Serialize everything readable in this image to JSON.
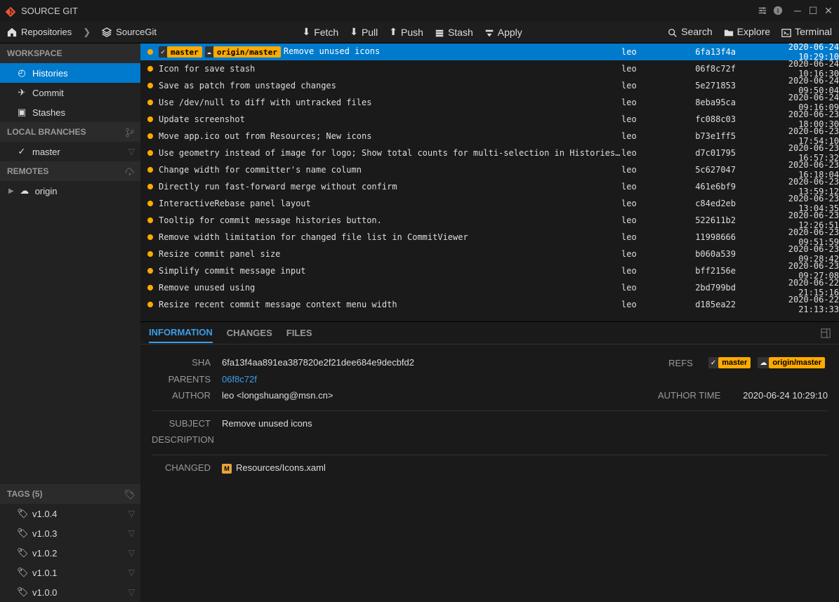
{
  "title": "SOURCE GIT",
  "breadcrumb": {
    "repositories": "Repositories",
    "current": "SourceGit"
  },
  "toolbar": {
    "fetch": "Fetch",
    "pull": "Pull",
    "push": "Push",
    "stash": "Stash",
    "apply": "Apply",
    "search": "Search",
    "explore": "Explore",
    "terminal": "Terminal"
  },
  "sidebar": {
    "workspace": {
      "label": "WORKSPACE",
      "items": [
        {
          "label": "Histories"
        },
        {
          "label": "Commit"
        },
        {
          "label": "Stashes"
        }
      ]
    },
    "local_branches": {
      "label": "LOCAL BRANCHES",
      "items": [
        {
          "label": "master"
        }
      ]
    },
    "remotes": {
      "label": "REMOTES",
      "items": [
        {
          "label": "origin"
        }
      ]
    },
    "tags": {
      "label": "TAGS (5)",
      "items": [
        {
          "label": "v1.0.4"
        },
        {
          "label": "v1.0.3"
        },
        {
          "label": "v1.0.2"
        },
        {
          "label": "v1.0.1"
        },
        {
          "label": "v1.0.0"
        }
      ]
    }
  },
  "refs": {
    "master": "master",
    "origin_master": "origin/master"
  },
  "commits": [
    {
      "msg": "Remove unused icons",
      "author": "leo",
      "sha": "6fa13f4a",
      "date": "2020-06-24 10:29:10",
      "selected": true,
      "badges": true
    },
    {
      "msg": "Icon for save stash",
      "author": "leo",
      "sha": "06f8c72f",
      "date": "2020-06-24 10:16:30"
    },
    {
      "msg": "Save as patch from unstaged changes",
      "author": "leo",
      "sha": "5e271853",
      "date": "2020-06-24 09:50:04"
    },
    {
      "msg": "Use /dev/null to diff with untracked files",
      "author": "leo",
      "sha": "8eba95ca",
      "date": "2020-06-24 09:16:09"
    },
    {
      "msg": "Update screenshot",
      "author": "leo",
      "sha": "fc088c03",
      "date": "2020-06-23 18:00:30"
    },
    {
      "msg": "Move app.ico out from Resources; New icons",
      "author": "leo",
      "sha": "b73e1ff5",
      "date": "2020-06-23 17:54:10"
    },
    {
      "msg": "Use geometry instead of image for logo; Show total counts for multi-selection in Histories' DataGrid",
      "author": "leo",
      "sha": "d7c01795",
      "date": "2020-06-23 16:57:32"
    },
    {
      "msg": "Change width for committer's name column",
      "author": "leo",
      "sha": "5c627047",
      "date": "2020-06-23 16:18:04"
    },
    {
      "msg": "Directly run fast-forward merge without confirm",
      "author": "leo",
      "sha": "461e6bf9",
      "date": "2020-06-23 13:59:12"
    },
    {
      "msg": "InteractiveRebase panel layout",
      "author": "leo",
      "sha": "c84ed2eb",
      "date": "2020-06-23 13:04:35"
    },
    {
      "msg": "Tooltip for commit message histories button.",
      "author": "leo",
      "sha": "522611b2",
      "date": "2020-06-23 12:26:51"
    },
    {
      "msg": "Remove width limitation for changed file list in CommitViewer",
      "author": "leo",
      "sha": "11998666",
      "date": "2020-06-23 09:51:59"
    },
    {
      "msg": "Resize commit panel size",
      "author": "leo",
      "sha": "b060a539",
      "date": "2020-06-23 09:28:42"
    },
    {
      "msg": "Simplify commit message input",
      "author": "leo",
      "sha": "bff2156e",
      "date": "2020-06-23 09:27:08"
    },
    {
      "msg": "Remove unused using",
      "author": "leo",
      "sha": "2bd799bd",
      "date": "2020-06-22 21:15:16"
    },
    {
      "msg": "Resize recent commit message context menu width",
      "author": "leo",
      "sha": "d185ea22",
      "date": "2020-06-22 21:13:33"
    }
  ],
  "tabs": {
    "information": "INFORMATION",
    "changes": "CHANGES",
    "files": "FILES"
  },
  "detail": {
    "labels": {
      "sha": "SHA",
      "parents": "PARENTS",
      "author": "AUTHOR",
      "author_time": "AUTHOR TIME",
      "refs": "REFS",
      "subject": "SUBJECT",
      "description": "DESCRIPTION",
      "changed": "CHANGED"
    },
    "sha": "6fa13f4aa891ea387820e2f21dee684e9decbfd2",
    "parents": "06f8c72f",
    "author": "leo <longshuang@msn.cn>",
    "author_time": "2020-06-24 10:29:10",
    "subject": "Remove unused icons",
    "changed_file": "Resources/Icons.xaml"
  }
}
